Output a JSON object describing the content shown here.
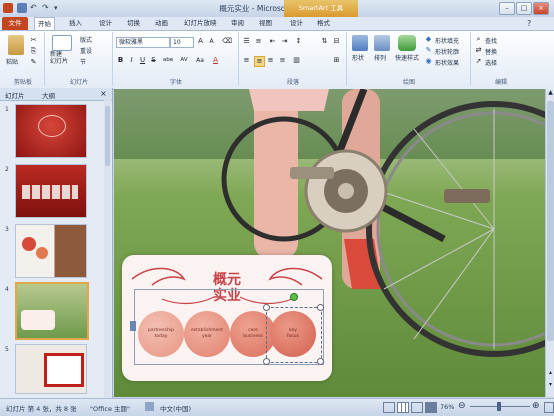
{
  "window": {
    "title": "概元实业 - Microsoft PowerPoint",
    "contextual_group": "SmartArt 工具",
    "controls": [
      "–",
      "□",
      "×"
    ]
  },
  "tabs": [
    {
      "label": "开始",
      "active": true
    },
    {
      "label": "插入"
    },
    {
      "label": "设计"
    },
    {
      "label": "切换"
    },
    {
      "label": "动画"
    },
    {
      "label": "幻灯片放映"
    },
    {
      "label": "审阅"
    },
    {
      "label": "视图"
    },
    {
      "label": "设计"
    },
    {
      "label": "格式"
    }
  ],
  "file_tab": "文件",
  "ribbon": {
    "clipboard": {
      "paste": "粘贴",
      "group": "剪贴板"
    },
    "slides": {
      "new_slide": "新建\n幻灯片",
      "layout": "版式",
      "reset": "重设",
      "section": "节",
      "group": "幻灯片"
    },
    "font": {
      "font_name": "微软雅黑",
      "font_size": "10",
      "group": "字体",
      "bold": "B",
      "italic": "I",
      "underline": "U",
      "strike": "S",
      "shadow": "abe",
      "spacing": "AV",
      "case": "Aa",
      "color": "A"
    },
    "paragraph": {
      "group": "段落"
    },
    "drawing": {
      "shape": "形状",
      "arrange": "排列",
      "quick_styles": "快速样式",
      "fill": "形状填充",
      "outline": "形状轮廓",
      "effects": "形状效果",
      "group": "绘图"
    },
    "editing": {
      "find": "查找",
      "replace": "替换",
      "select": "选择",
      "group": "编辑"
    }
  },
  "pane": {
    "tab_slides": "幻灯片",
    "tab_outline": "大纲",
    "thumb_numbers": [
      "1",
      "2",
      "3",
      "4",
      "5"
    ]
  },
  "slide": {
    "title_line1": "概元",
    "title_line2": "实业",
    "circles": [
      "partnership\ntoday",
      "establishment\nyear",
      "core\nbusiness",
      "key\nfocus"
    ]
  },
  "status": {
    "slide_info": "幻灯片 第 4 张，共 8 张",
    "theme": "\"Office 主题\"",
    "language": "中文(中国)",
    "zoom": "76%"
  }
}
